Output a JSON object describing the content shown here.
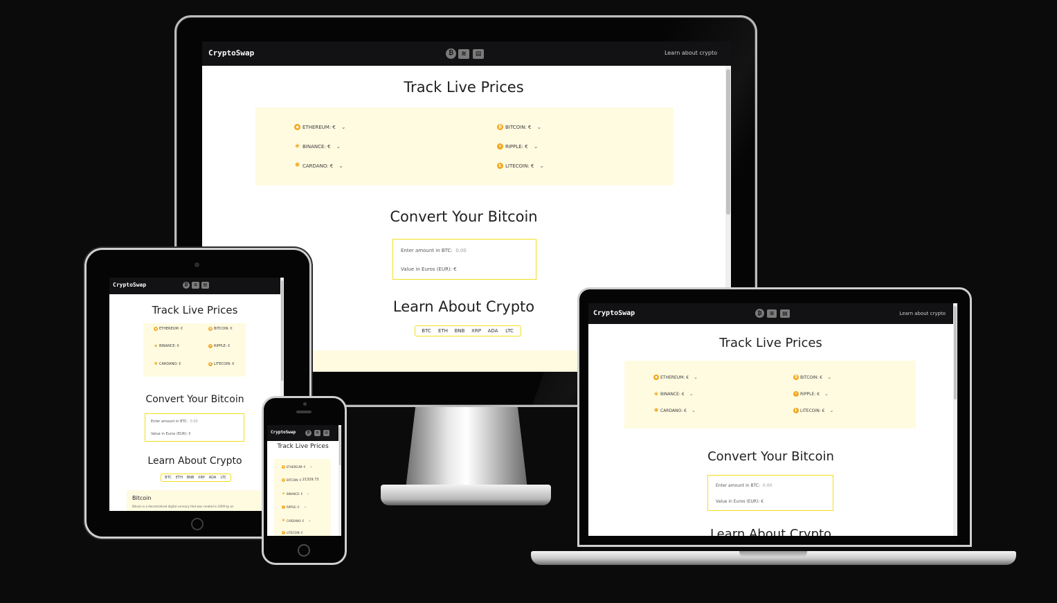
{
  "site": {
    "logo": "CryptoSwap",
    "nav_link": "Learn about crypto",
    "nav_icons": [
      "bitcoin-icon",
      "coins-icon",
      "newspaper-icon"
    ]
  },
  "prices": {
    "heading": "Track Live Prices",
    "items": [
      {
        "label": "ETHEREUM: €",
        "icon": "ethereum-icon"
      },
      {
        "label": "BITCOIN: €",
        "icon": "bitcoin-icon"
      },
      {
        "label": "BINANCE: €",
        "icon": "binance-icon"
      },
      {
        "label": "RIPPLE: €",
        "icon": "ripple-icon"
      },
      {
        "label": "CARDANO: €",
        "icon": "cardano-icon"
      },
      {
        "label": "LITECOIN: €",
        "icon": "litecoin-icon"
      }
    ],
    "phone_bitcoin_value": "21329.73"
  },
  "convert": {
    "heading": "Convert Your Bitcoin",
    "amount_label": "Enter amount in BTC:",
    "amount_placeholder": "0.00",
    "value_label": "Value in Euros (EUR): €"
  },
  "learn": {
    "heading": "Learn About Crypto",
    "tabs": [
      "BTC",
      "ETH",
      "BNB",
      "XRP",
      "ADA",
      "LTC"
    ],
    "card_title": "Bitcoin",
    "card_text": "Bitcoin is a decentralised digital currency that was created in 2009 by an"
  },
  "colors": {
    "nav_bg": "#121214",
    "accent_yellow": "#f3dd1c",
    "panel_bg": "#fffbe1",
    "coin_orange": "#f2a71d"
  }
}
